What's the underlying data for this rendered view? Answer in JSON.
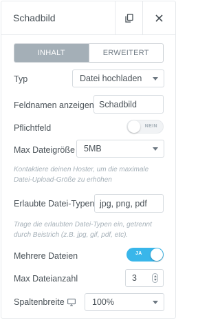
{
  "header": {
    "title": "Schadbild",
    "copy_icon": "duplicate-icon",
    "close_icon": "close-icon"
  },
  "tabs": [
    {
      "label": "INHALT",
      "active": true
    },
    {
      "label": "ERWEITERT",
      "active": false
    }
  ],
  "fields": {
    "type": {
      "label": "Typ",
      "value": "Datei hochladen"
    },
    "field_name": {
      "label": "Feldnamen anzeigen",
      "value": "Schadbild"
    },
    "required": {
      "label": "Pflichtfeld",
      "toggle_text": "NEIN",
      "on": false
    },
    "max_size": {
      "label": "Max Dateigröße",
      "value": "5MB",
      "help": "Kontaktiere deinen Hoster, um die maximale Datei-Upload-Größe zu erhöhen"
    },
    "allowed_types": {
      "label": "Erlaubte Datei-Typen",
      "value": "jpg, png, pdf",
      "help": "Trage die erlaubten Datei-Typen ein, getrennt durch Beistrich (z.B. jpg, gif, pdf, etc)."
    },
    "multiple": {
      "label": "Mehrere Dateien",
      "toggle_text": "JA",
      "on": true
    },
    "max_count": {
      "label": "Max Dateianzahl",
      "value": "3"
    },
    "column_width": {
      "label": "Spaltenbreite",
      "icon": "desktop-icon",
      "value": "100%"
    }
  },
  "colors": {
    "accent": "#39b6ea",
    "active_tab": "#a4afb7"
  }
}
